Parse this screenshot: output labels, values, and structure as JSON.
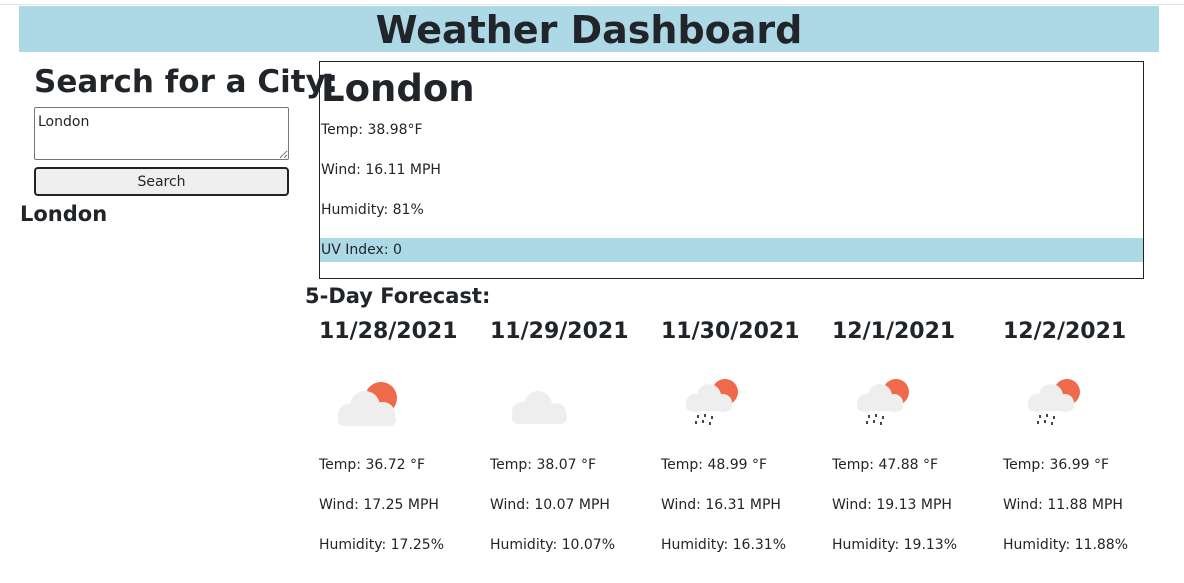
{
  "header": {
    "title": "Weather Dashboard"
  },
  "search": {
    "heading": "Search for a City:",
    "input_value": "London",
    "button_label": "Search",
    "history": [
      "London"
    ]
  },
  "current": {
    "city": "London",
    "temp": "Temp: 38.98°F",
    "wind": "Wind: 16.11 MPH",
    "humidity": "Humidity: 81%",
    "uv": "UV Index: 0",
    "uv_color": "#add8e6"
  },
  "forecast": {
    "heading": "5-Day Forecast:",
    "days": [
      {
        "date": "11/28/2021",
        "icon": "partly-cloudy-icon",
        "temp": "Temp: 36.72 °F",
        "wind": "Wind: 17.25 MPH",
        "humidity": "Humidity: 17.25%"
      },
      {
        "date": "11/29/2021",
        "icon": "cloud-icon",
        "temp": "Temp: 38.07 °F",
        "wind": "Wind: 10.07 MPH",
        "humidity": "Humidity: 10.07%"
      },
      {
        "date": "11/30/2021",
        "icon": "sun-rain-icon",
        "temp": "Temp: 48.99 °F",
        "wind": "Wind: 16.31 MPH",
        "humidity": "Humidity: 16.31%"
      },
      {
        "date": "12/1/2021",
        "icon": "sun-rain-icon",
        "temp": "Temp: 47.88 °F",
        "wind": "Wind: 19.13 MPH",
        "humidity": "Humidity: 19.13%"
      },
      {
        "date": "12/2/2021",
        "icon": "sun-rain-icon",
        "temp": "Temp: 36.99 °F",
        "wind": "Wind: 11.88 MPH",
        "humidity": "Humidity: 11.88%"
      }
    ]
  },
  "colors": {
    "header_bg": "#add8e6",
    "sun": "#ef6a4a",
    "cloud": "#eeeeee"
  }
}
